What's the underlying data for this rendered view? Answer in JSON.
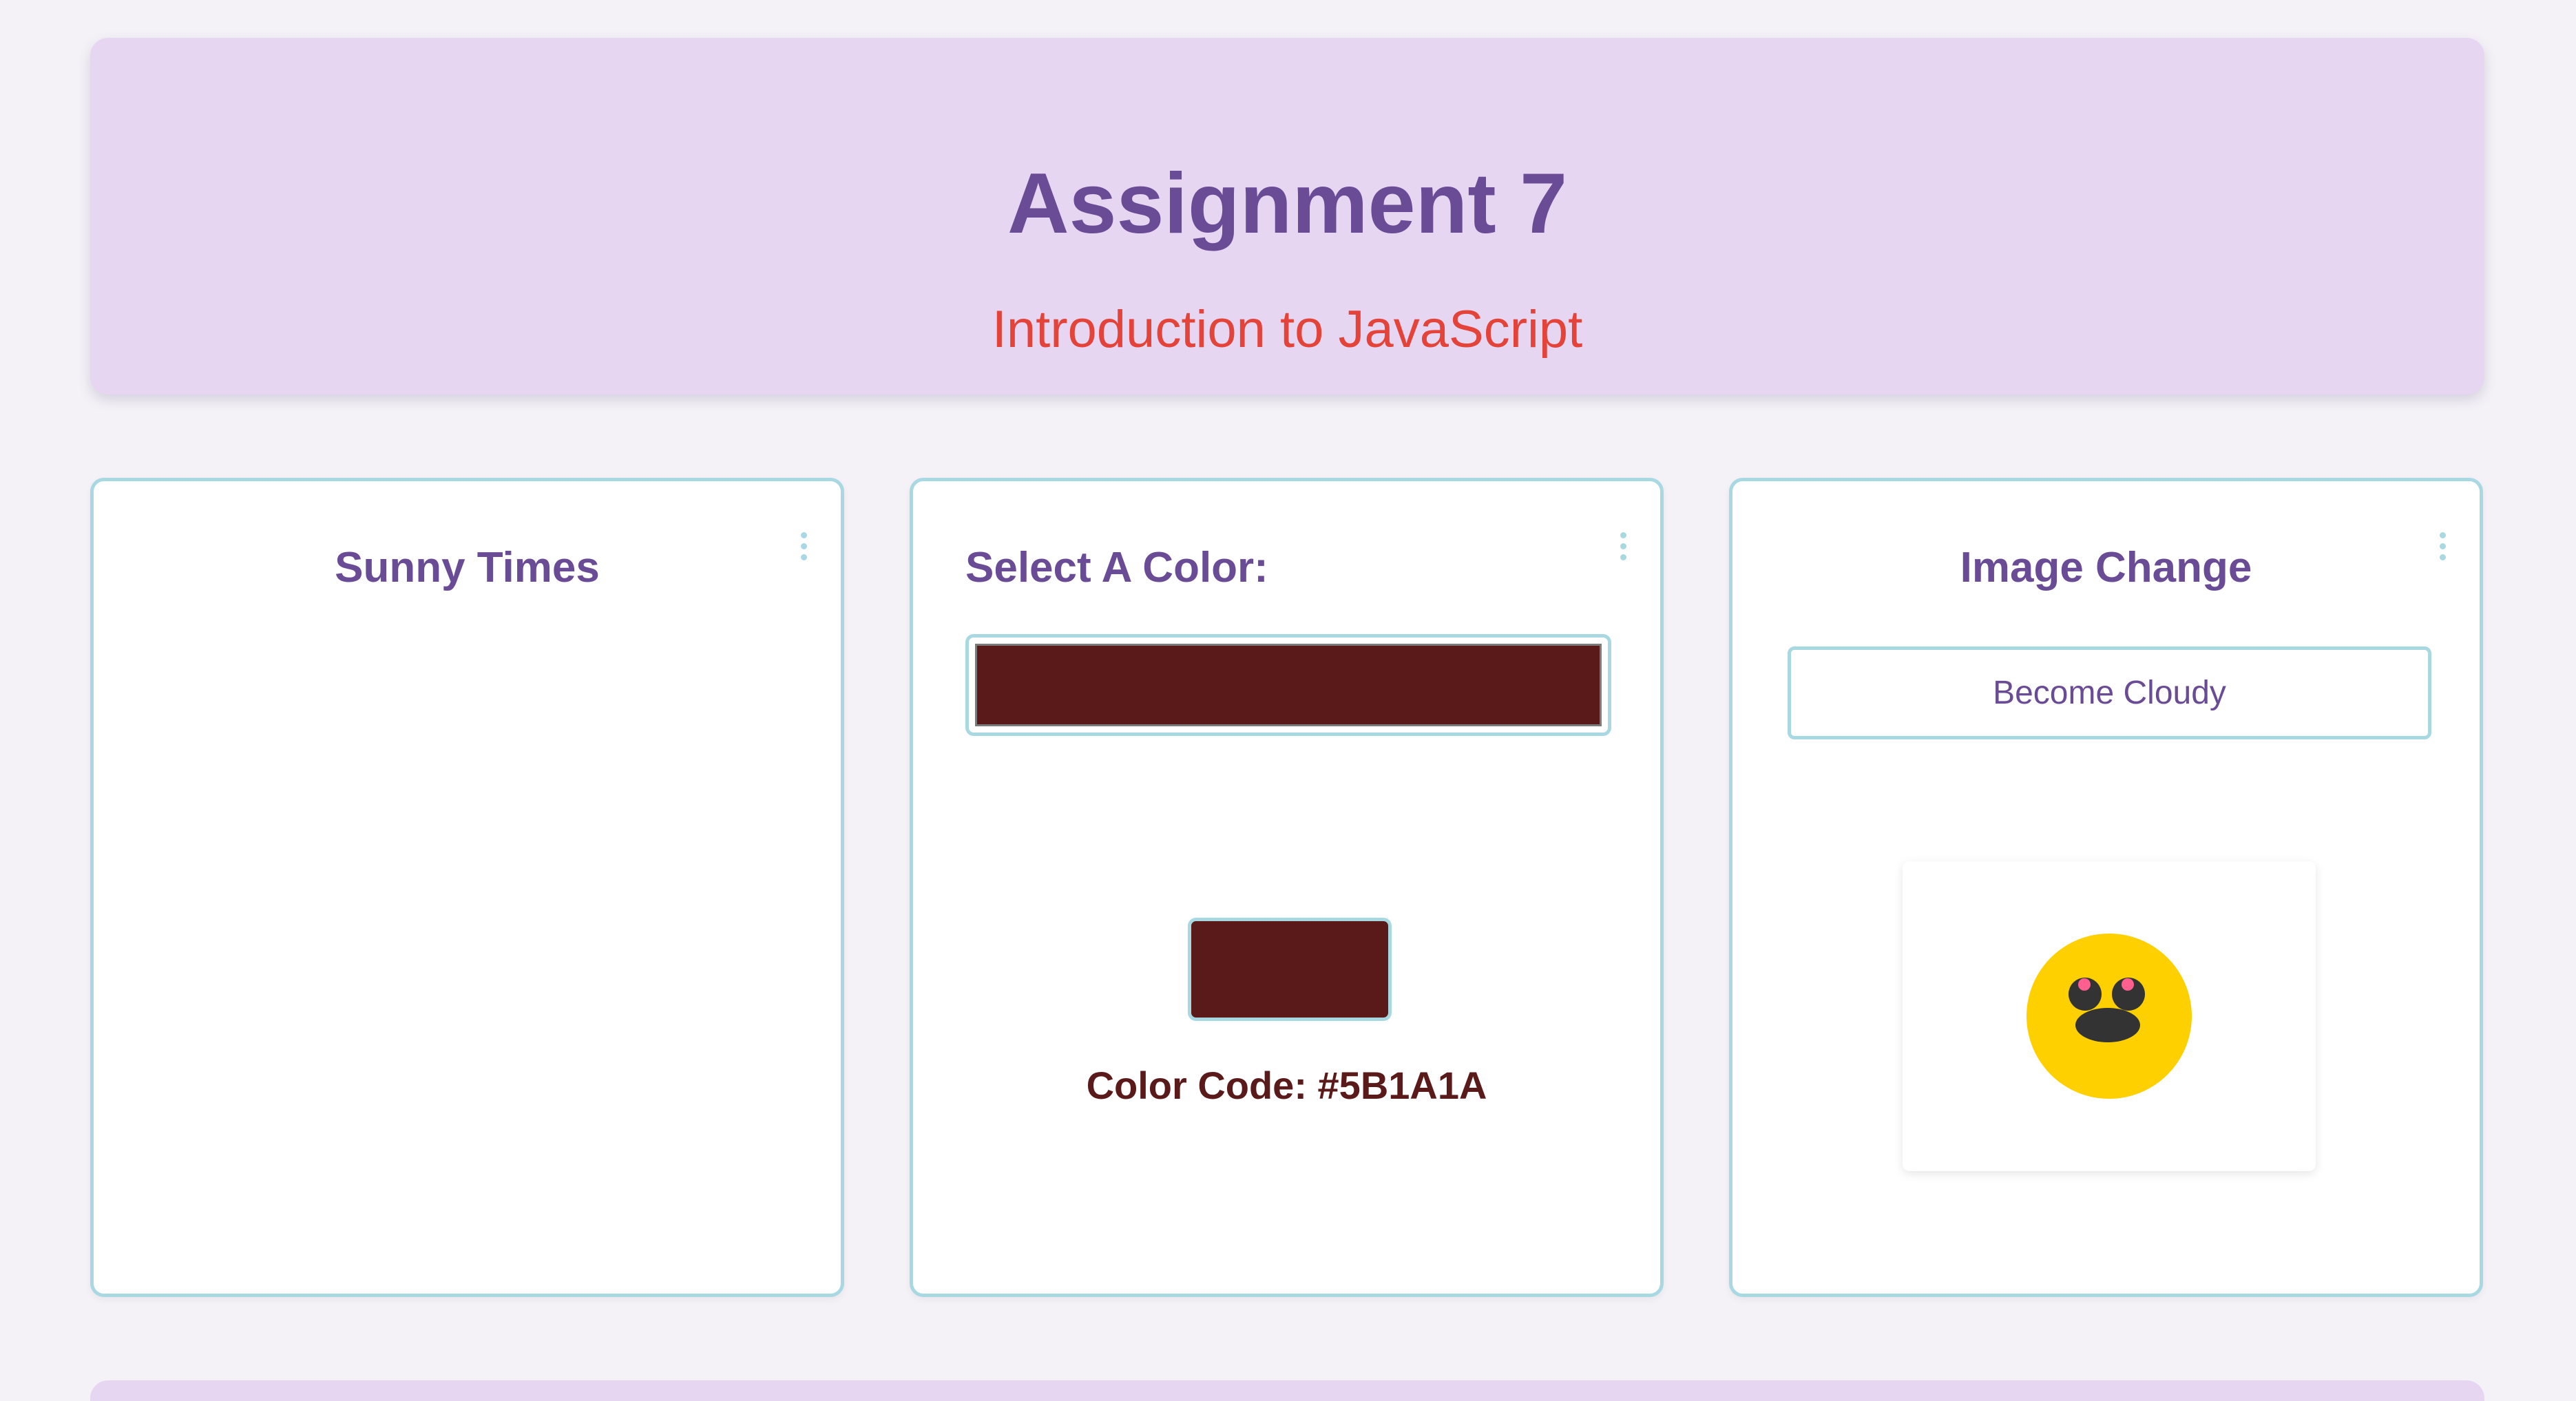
{
  "header": {
    "title": "Assignment 7",
    "subtitle": "Introduction to JavaScript"
  },
  "cards": {
    "sunny": {
      "title": "Sunny Times"
    },
    "color": {
      "title": "Select A Color:",
      "selected_color": "#5B1A1A",
      "code_label": "Color Code: #5B1A1A"
    },
    "image": {
      "title": "Image Change",
      "button_label": "Become Cloudy",
      "emoji_color": "#FFD000"
    }
  },
  "icons": {
    "kebab": "more-vertical-icon"
  },
  "colors": {
    "accent": "#6A4B95",
    "subtitle": "#E4433A",
    "border": "#A8D8E2",
    "header_bg": "#E7D6F1",
    "page_bg": "#F4F2F7"
  }
}
